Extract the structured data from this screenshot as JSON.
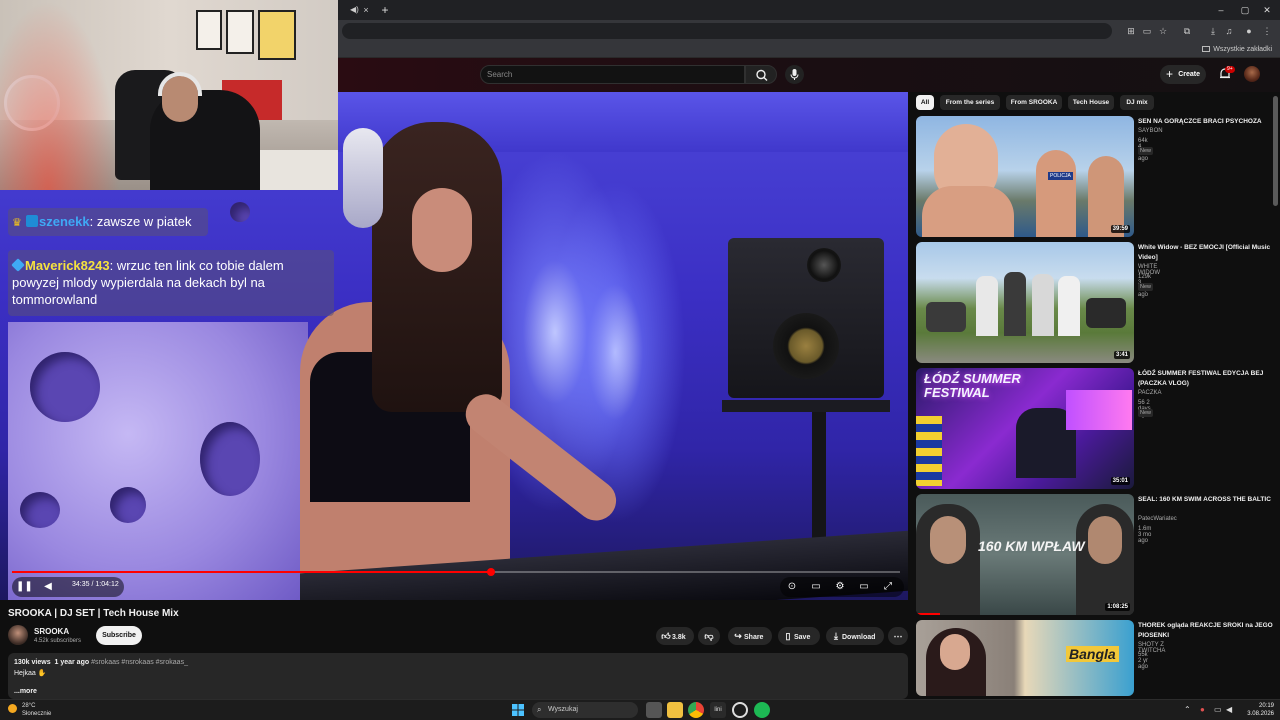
{
  "browser": {
    "tab_close": "×",
    "new_tab": "+",
    "bookmarks_folder": "Wszystkie zakładki",
    "window_controls": [
      "–",
      "▢",
      "✕"
    ]
  },
  "masthead": {
    "search_placeholder": "Search",
    "create_label": "Create",
    "notif_badge": "9+"
  },
  "chat": [
    {
      "user": "szenekk",
      "message": "zawsze w piatek"
    },
    {
      "user": "Maverick8243",
      "message": "wrzuc ten link co tobie dalem powyzej mlody wypierdala na dekach byl na tommorowland"
    }
  ],
  "player": {
    "time_current": "34:35",
    "time_total": "1:04:12",
    "progress": 0.539
  },
  "video": {
    "title": "SROOKA | DJ SET | Tech House Mix",
    "channel": "SROOKA",
    "subscribers": "4.52k subscribers",
    "subscribe_label": "Subscribe",
    "likes": "3.8k",
    "share_label": "Share",
    "save_label": "Save",
    "download_label": "Download",
    "views": "130k views",
    "age": "1 year ago",
    "hashtags": "#srokaas #nsrokaas #srokaas_",
    "description": "Hejkaa",
    "more_label": "...more"
  },
  "chips": [
    "All",
    "From the series",
    "From SROOKA",
    "Tech House",
    "DJ mix"
  ],
  "recommendations": [
    {
      "title": "SEN NA GORĄCZCE BRACI PSYCHOZA",
      "channel": "SAYBON",
      "meta": "64k  4 hr ago",
      "badge": "New",
      "duration": "39:59"
    },
    {
      "title": "White Widow - BEZ EMOCJI [Official Music Video]",
      "channel": "WHITE WIDOW",
      "meta": "129k  3 days ago",
      "badge": "New",
      "duration": "3:41"
    },
    {
      "title": "ŁÓDŹ SUMMER FESTIWAL EDYCJA BEJ (PACZKA VLOG)",
      "channel": "PACZKA",
      "meta": "56  2 days ago",
      "badge": "New",
      "duration": "35:01"
    },
    {
      "title": "SEAL: 160 KM SWIM ACROSS THE BALTIC",
      "channel": "PatecWariatec",
      "meta": "1.6m  3 mo ago",
      "badge": "",
      "duration": "1:08:25"
    },
    {
      "title": "THOREK ogląda REAKCJE SROKI na JEGO PIOSENKI",
      "channel": "SHOTY Z TWITCHA",
      "meta": "55k  2 yr ago",
      "badge": "",
      "duration": ""
    }
  ],
  "thumb_text": {
    "police": "POLICJA",
    "festival": "ŁÓDŹ SUMMER FESTIWAL",
    "swim": "160 KM WPŁAW",
    "bangla": "Bangla"
  },
  "taskbar": {
    "temp": "28°C",
    "weather": "Słonecznie",
    "search_label": "Wyszukaj",
    "time": "20:19",
    "date": "3.08.2026"
  }
}
